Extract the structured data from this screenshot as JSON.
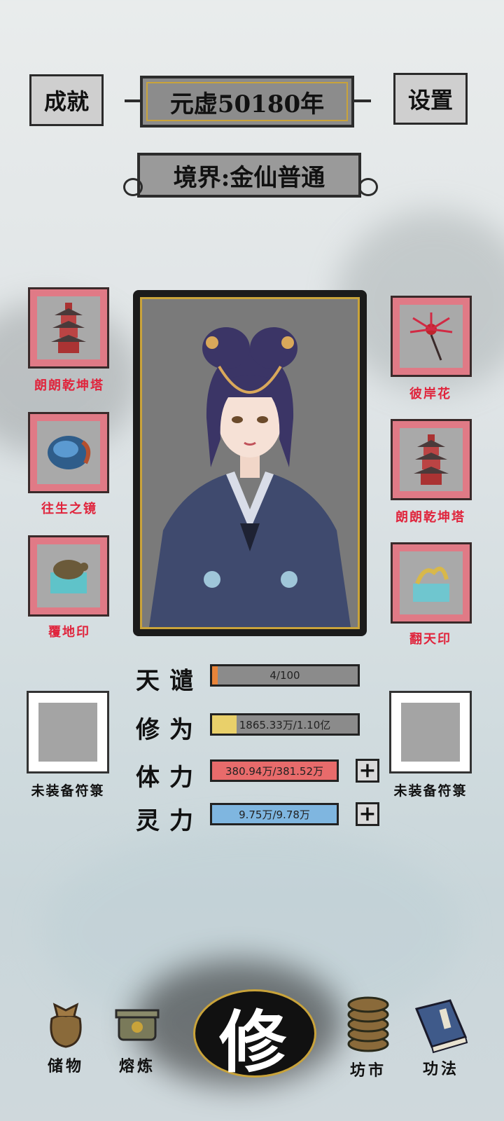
{
  "header": {
    "achievements_label": "成就",
    "year_label": "元虚50180年",
    "settings_label": "设置",
    "realm_label": "境界:金仙普通"
  },
  "equipment": {
    "left": [
      {
        "name": "朗朗乾坤塔",
        "icon": "pagoda-icon"
      },
      {
        "name": "往生之镜",
        "icon": "mirror-icon"
      },
      {
        "name": "覆地印",
        "icon": "turtle-seal-icon"
      }
    ],
    "right": [
      {
        "name": "彼岸花",
        "icon": "spider-lily-icon"
      },
      {
        "name": "朗朗乾坤塔",
        "icon": "pagoda-icon"
      },
      {
        "name": "翻天印",
        "icon": "dragon-seal-icon"
      }
    ]
  },
  "talisman": {
    "left_label": "未装备符箓",
    "right_label": "未装备符箓"
  },
  "stats": [
    {
      "name": "天谴",
      "text": "4/100",
      "fraction": 0.04,
      "color": "#e8843a"
    },
    {
      "name": "修为",
      "text": "1865.33万/1.10亿",
      "fraction": 0.17,
      "color": "#e9d06a"
    },
    {
      "name": "体力",
      "text": "380.94万/381.52万",
      "fraction": 1.0,
      "color": "#e86b6b"
    },
    {
      "name": "灵力",
      "text": "9.75万/9.78万",
      "fraction": 1.0,
      "color": "#7fb6e0"
    }
  ],
  "nav": {
    "storage": "储物",
    "smelting": "熔炼",
    "cultivate": "修",
    "market": "坊市",
    "techniques": "功法"
  },
  "colors": {
    "slot_frame": "#e07a86",
    "label_red": "#e0243c",
    "gold": "#c9a33a"
  }
}
